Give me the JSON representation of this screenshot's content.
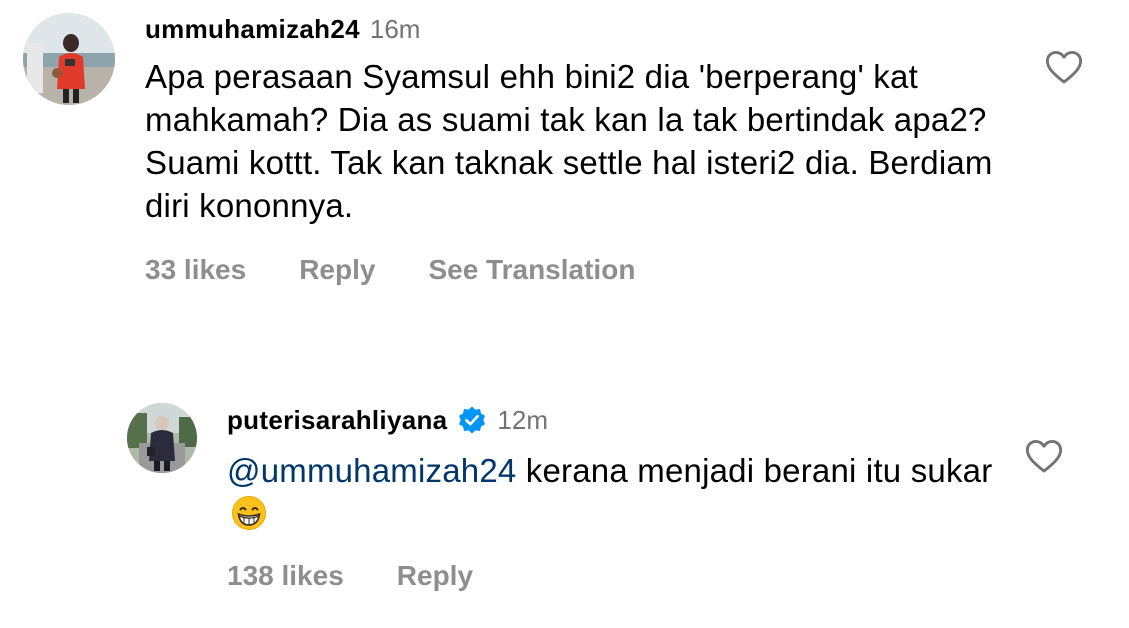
{
  "comments": [
    {
      "username": "ummuhamizah24",
      "time": "16m",
      "text": "Apa perasaan Syamsul ehh bini2 dia 'berperang' kat mahkamah? Dia as suami tak kan la tak bertindak apa2? Suami kottt. Tak kan taknak settle hal isteri2 dia. Berdiam diri kononnya.",
      "likes": "33 likes",
      "reply_label": "Reply",
      "translation_label": "See Translation",
      "icons": [
        "avatar",
        "heart-icon"
      ]
    },
    {
      "username": "puterisarahliyana",
      "verified": true,
      "time": "12m",
      "mention": "@ummuhamizah24",
      "text": " kerana menjadi berani itu sukar",
      "emoji": "grinning-face-with-smiling-eyes",
      "likes": "138 likes",
      "reply_label": "Reply",
      "icons": [
        "avatar",
        "verified-badge-icon",
        "heart-icon"
      ]
    }
  ],
  "colors": {
    "secondary_text": "#737373",
    "action_text": "#8e8e8e",
    "mention": "#00376b",
    "verified_badge": "#0095f6"
  }
}
